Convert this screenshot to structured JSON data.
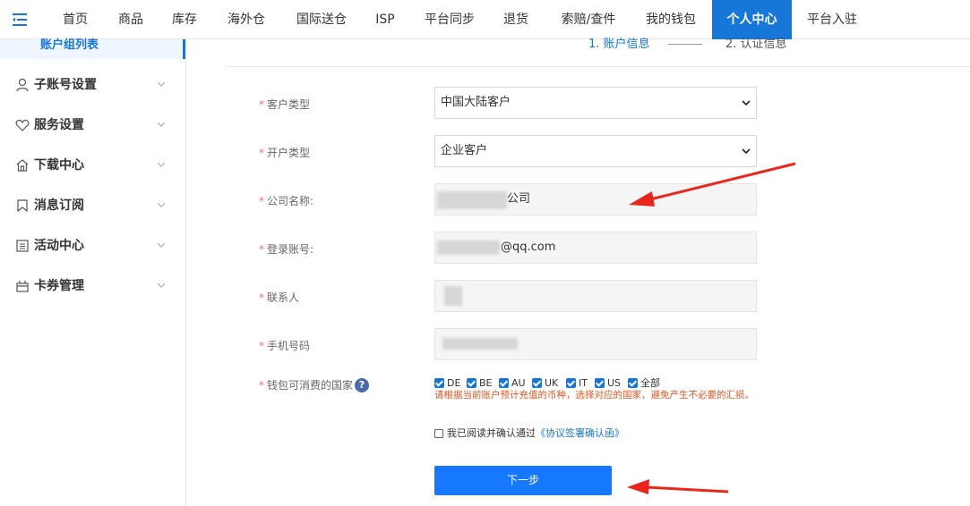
{
  "nav": {
    "items": [
      "首页",
      "商品",
      "库存",
      "海外仓",
      "国际送仓",
      "ISP",
      "平台同步",
      "退货",
      "索赔/查件",
      "我的钱包",
      "个人中心",
      "平台入驻"
    ],
    "active": "个人中心"
  },
  "sidebar": {
    "top_item": "账户组列表",
    "items": [
      {
        "label": "子账号设置",
        "icon": "user-icon"
      },
      {
        "label": "服务设置",
        "icon": "heart-icon"
      },
      {
        "label": "下载中心",
        "icon": "home-icon"
      },
      {
        "label": "消息订阅",
        "icon": "bookmark-icon"
      },
      {
        "label": "活动中心",
        "icon": "list-icon"
      },
      {
        "label": "卡券管理",
        "icon": "gift-icon"
      }
    ]
  },
  "steps": {
    "step1": "1. 账户信息",
    "step2": "2. 认证信息",
    "current": 1
  },
  "form": {
    "customer_type": {
      "label": "客户类型",
      "value": "中国大陆客户"
    },
    "account_type": {
      "label": "开户类型",
      "value": "企业客户"
    },
    "company_name": {
      "label": "公司名称:",
      "value": "公司"
    },
    "login_account": {
      "label": "登录账号:",
      "value": "@qq.com"
    },
    "contact": {
      "label": "联系人",
      "value": ""
    },
    "phone": {
      "label": "手机号码",
      "value": ""
    },
    "countries": {
      "label": "钱包可消费的国家",
      "options": [
        "DE",
        "BE",
        "AU",
        "UK",
        "IT",
        "US",
        "全部"
      ],
      "warning": "请根据当前账户预计充值的币种，选择对应的国家，避免产生不必要的汇损。"
    },
    "agreement": {
      "prefix": "我已阅读并确认通过",
      "link": "《协议签署确认函》",
      "checked": false
    },
    "next_button": "下一步"
  },
  "colors": {
    "brand": "#1677d9",
    "warning": "#e8541f",
    "required": "#f56c6c",
    "annotation_arrow": "#e8261c"
  }
}
